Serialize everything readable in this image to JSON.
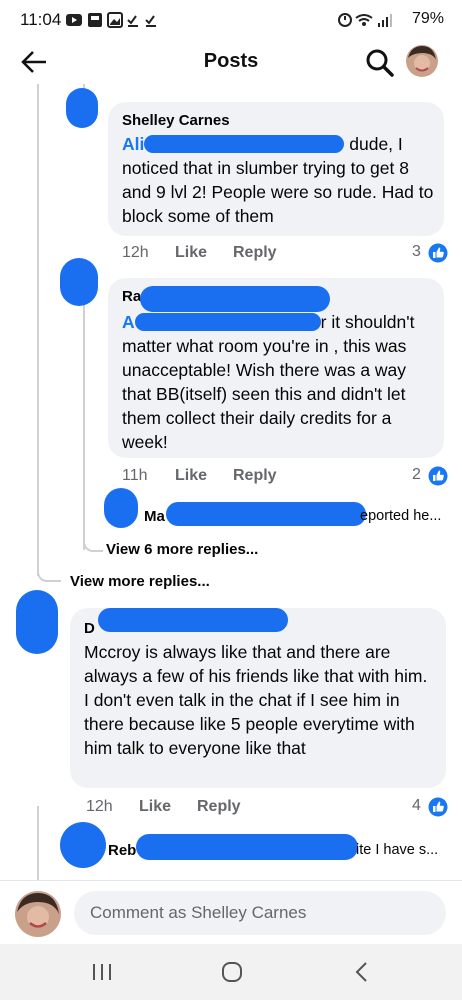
{
  "status_bar": {
    "time": "11:04",
    "battery": "79%"
  },
  "header": {
    "title": "Posts"
  },
  "comments": [
    {
      "author": "Shelley Carnes",
      "tag": "Ali",
      "text_first": "dude, I",
      "text_rest": "noticed that in slumber trying to get 8 and 9 lvl 2! People were so rude. Had to block some of them",
      "time": "12h",
      "like_label": "Like",
      "reply_label": "Reply",
      "reactions": "3"
    },
    {
      "author": "Ra",
      "tag": "A",
      "text_first": "r it shouldn't",
      "text_rest": "matter what room you're in , this was unacceptable!   Wish there was a way that BB(itself) seen this and didn't let them collect their daily credits for a week!",
      "time": "11h",
      "like_label": "Like",
      "reply_label": "Reply",
      "reactions": "2"
    },
    {
      "author": "D",
      "text": "Mccroy is always like that and there are always a few of his friends like that with him. I don't even talk in the chat if I see him in there because like 5 people everytime with him talk to everyone like that",
      "time": "12h",
      "like_label": "Like",
      "reply_label": "Reply",
      "reactions": "4"
    }
  ],
  "collapsed_replies": [
    {
      "name": "Ma",
      "snippet": "eported he..."
    },
    {
      "name": "Reb",
      "snippet": "ite I have s..."
    }
  ],
  "view_links": {
    "view_6_more": "View 6 more replies...",
    "view_more": "View more replies..."
  },
  "composer": {
    "placeholder": "Comment as Shelley Carnes"
  },
  "colors": {
    "accent": "#1877f2",
    "redaction": "#1a6ff0",
    "bubble": "#f0f2f5",
    "secondary_text": "#65676b"
  }
}
